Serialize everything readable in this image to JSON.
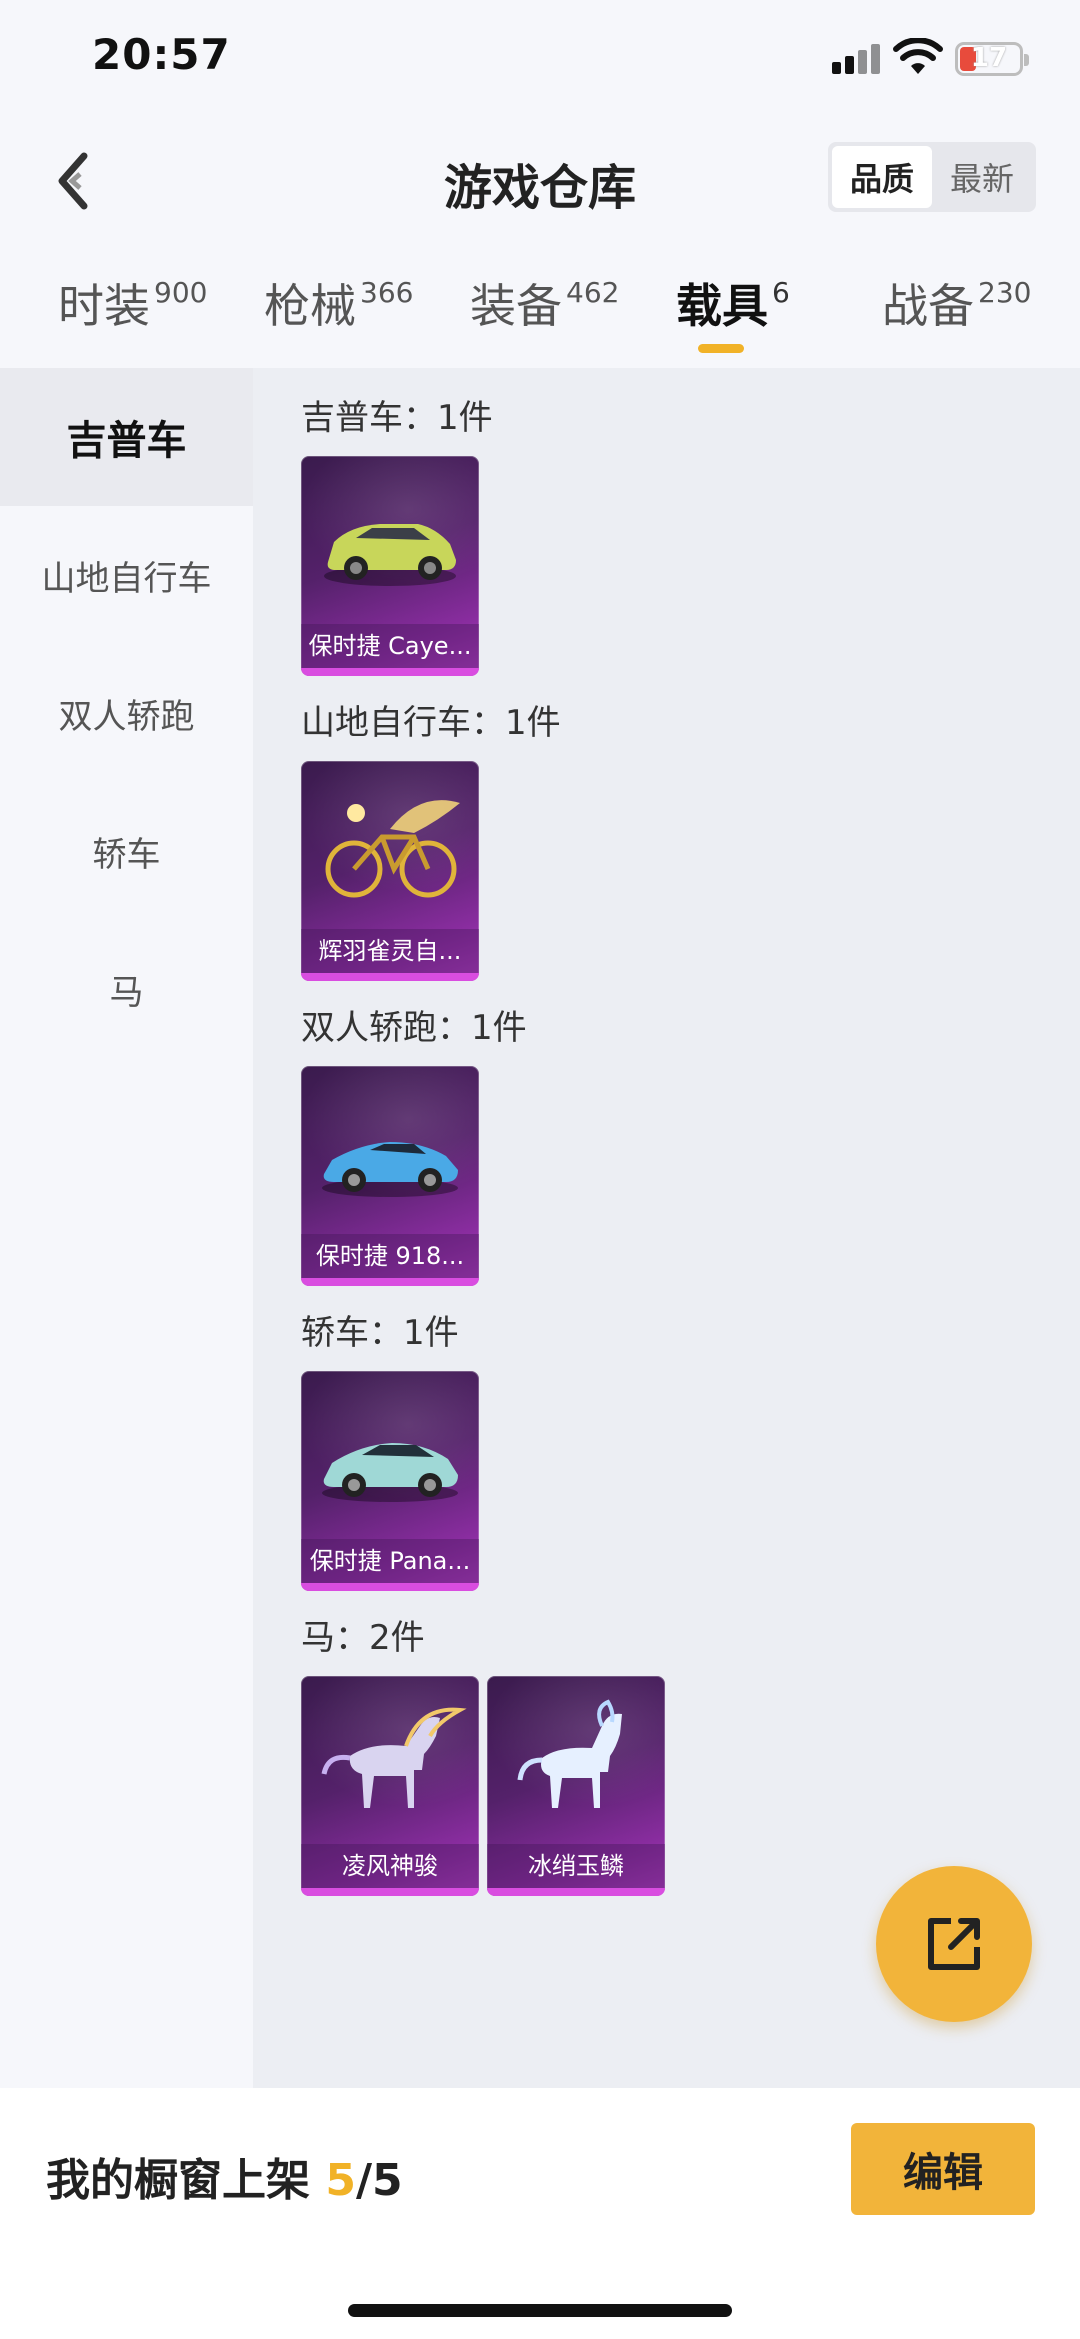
{
  "status": {
    "time": "20:57",
    "battery": "17"
  },
  "nav": {
    "title": "游戏仓库",
    "sort_options": [
      "品质",
      "最新"
    ],
    "sort_active": 0
  },
  "tabs": [
    {
      "label": "时装",
      "count": "900"
    },
    {
      "label": "枪械",
      "count": "366"
    },
    {
      "label": "装备",
      "count": "462"
    },
    {
      "label": "载具",
      "count": "6"
    },
    {
      "label": "战备",
      "count": "230"
    }
  ],
  "active_tab": 3,
  "categories": [
    "吉普车",
    "山地自行车",
    "双人轿跑",
    "轿车",
    "马"
  ],
  "active_category": 0,
  "groups": [
    {
      "title": "吉普车：1件",
      "items": [
        {
          "name": "保时捷 Caye...",
          "icon": "suv-car-icon",
          "color": "#c8d65a"
        }
      ]
    },
    {
      "title": "山地自行车：1件",
      "items": [
        {
          "name": "辉羽雀灵自...",
          "icon": "bicycle-icon",
          "color": "#e0b43a"
        }
      ]
    },
    {
      "title": "双人轿跑：1件",
      "items": [
        {
          "name": "保时捷 918...",
          "icon": "sports-car-icon",
          "color": "#4aa9e6"
        }
      ]
    },
    {
      "title": "轿车：1件",
      "items": [
        {
          "name": "保时捷 Pana...",
          "icon": "sedan-car-icon",
          "color": "#9fd8d6"
        }
      ]
    },
    {
      "title": "马：2件",
      "items": [
        {
          "name": "凌风神骏",
          "icon": "horse-icon",
          "color": "#d9d4f0"
        },
        {
          "name": "冰绡玉鳞",
          "icon": "horse-icon",
          "color": "#e6f0ff"
        }
      ]
    }
  ],
  "showcase": {
    "label": "我的橱窗上架",
    "current": "5",
    "total": "/5"
  },
  "edit_label": "编辑",
  "accent": "#f2b43a"
}
